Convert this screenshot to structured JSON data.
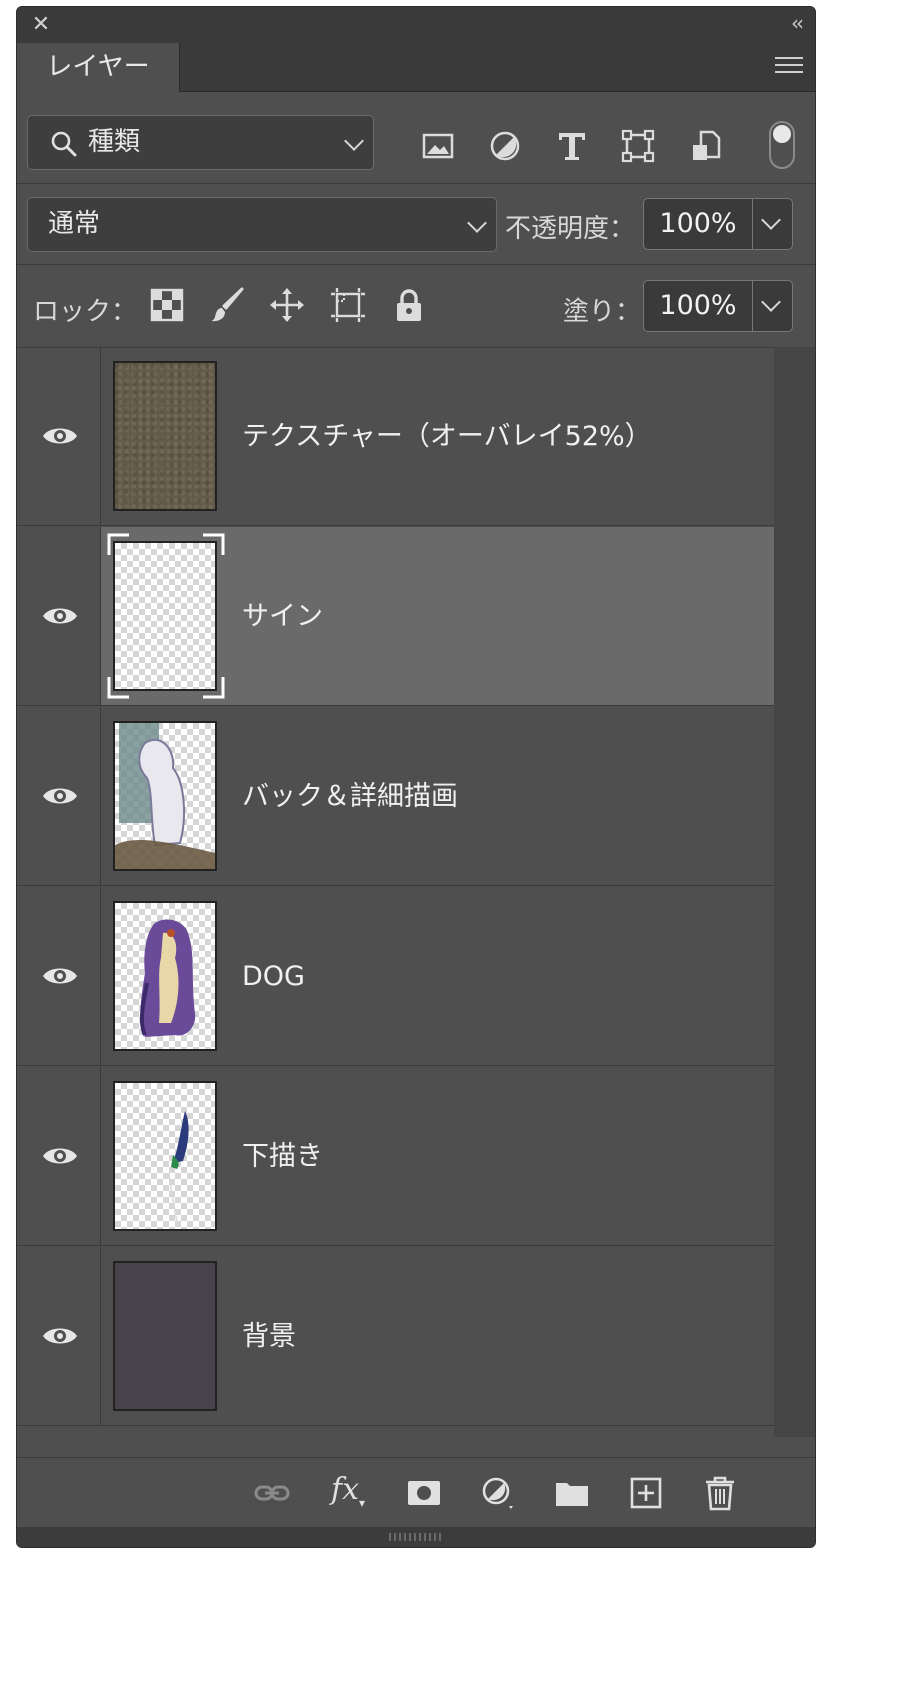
{
  "panel": {
    "tab_label": "レイヤー"
  },
  "filter": {
    "kind_label": "種類",
    "icons": [
      "image-filter-icon",
      "adjustment-filter-icon",
      "type-filter-icon",
      "shape-filter-icon",
      "smart-object-filter-icon"
    ]
  },
  "blend": {
    "mode": "通常",
    "opacity_label": "不透明度：",
    "opacity_value": "100%"
  },
  "lock": {
    "label": "ロック：",
    "fill_label": "塗り：",
    "fill_value": "100%"
  },
  "layers": [
    {
      "name": "テクスチャー（オーバレイ52%）",
      "visible": true,
      "selected": false,
      "thumb": "texture",
      "color": "#645a48"
    },
    {
      "name": "サイン",
      "visible": true,
      "selected": true,
      "thumb": "empty"
    },
    {
      "name": "バック＆詳細描画",
      "visible": true,
      "selected": false,
      "thumb": "sketch-back"
    },
    {
      "name": "DOG",
      "visible": true,
      "selected": false,
      "thumb": "dog"
    },
    {
      "name": "下描き",
      "visible": true,
      "selected": false,
      "thumb": "draft"
    },
    {
      "name": "背景",
      "visible": true,
      "selected": false,
      "thumb": "solid",
      "color": "#48434a"
    }
  ],
  "bottom_icons": [
    "link-layers-icon",
    "fx-icon",
    "add-mask-icon",
    "new-adjustment-layer-icon",
    "new-group-icon",
    "new-layer-icon",
    "delete-layer-icon"
  ],
  "colors": {
    "panel_bg": "#4f4f4f",
    "selected_row": "#6a6a6a",
    "text": "#f0f0f0"
  }
}
